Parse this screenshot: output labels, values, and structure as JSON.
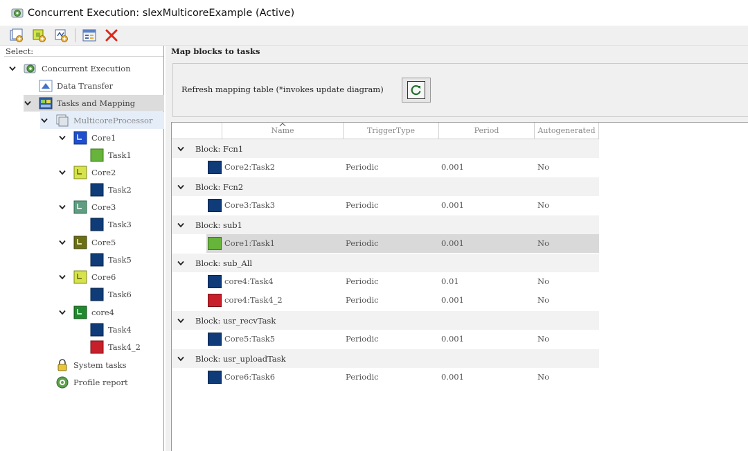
{
  "window": {
    "title": "Concurrent Execution: slexMulticoreExample (Active)"
  },
  "toolbar": {
    "icons": [
      "add-task-icon",
      "add-core-icon",
      "add-periodic-icon",
      "properties-icon",
      "delete-icon"
    ]
  },
  "left_pane": {
    "header": "Select:",
    "tree": {
      "root": "Concurrent Execution",
      "data_transfer": "Data Transfer",
      "tasks_mapping": "Tasks and Mapping",
      "processor": "MulticoreProcessor",
      "cores": [
        {
          "name": "Core1",
          "color": "#1f4fcf",
          "tasks": [
            {
              "name": "Task1",
              "color": "#66b43a"
            }
          ]
        },
        {
          "name": "Core2",
          "color": "#d7e34c",
          "tasks": [
            {
              "name": "Task2",
              "color": "#0f3b78"
            }
          ]
        },
        {
          "name": "Core3",
          "color": "#5f9e82",
          "tasks": [
            {
              "name": "Task3",
              "color": "#0f3b78"
            }
          ]
        },
        {
          "name": "Core5",
          "color": "#6b6f14",
          "tasks": [
            {
              "name": "Task5",
              "color": "#0f3b78"
            }
          ]
        },
        {
          "name": "Core6",
          "color": "#d7e34c",
          "tasks": [
            {
              "name": "Task6",
              "color": "#0f3b78"
            }
          ]
        },
        {
          "name": "core4",
          "color": "#21892d",
          "tasks": [
            {
              "name": "Task4",
              "color": "#0f3b78"
            },
            {
              "name": "Task4_2",
              "color": "#c8202a"
            }
          ]
        }
      ],
      "system_tasks": "System tasks",
      "profile_report": "Profile report"
    }
  },
  "right_pane": {
    "title": "Map blocks to tasks",
    "refresh_label": "Refresh mapping table (*invokes update diagram)",
    "columns": [
      "Name",
      "TriggerType",
      "Period",
      "Autogenerated"
    ],
    "groups": [
      {
        "block": "Block: Fcn1",
        "rows": [
          {
            "name": "Core2:Task2",
            "trigger": "Periodic",
            "period": "0.001",
            "auto": "No",
            "color": "#0f3b78"
          }
        ]
      },
      {
        "block": "Block: Fcn2",
        "rows": [
          {
            "name": "Core3:Task3",
            "trigger": "Periodic",
            "period": "0.001",
            "auto": "No",
            "color": "#0f3b78"
          }
        ]
      },
      {
        "block": "Block: sub1",
        "rows": [
          {
            "name": "Core1:Task1",
            "trigger": "Periodic",
            "period": "0.001",
            "auto": "No",
            "color": "#66b43a"
          }
        ]
      },
      {
        "block": "Block: sub_All",
        "rows": [
          {
            "name": "core4:Task4",
            "trigger": "Periodic",
            "period": "0.01",
            "auto": "No",
            "color": "#0f3b78"
          },
          {
            "name": "core4:Task4_2",
            "trigger": "Periodic",
            "period": "0.001",
            "auto": "No",
            "color": "#c8202a"
          }
        ]
      },
      {
        "block": "Block: usr_recvTask",
        "rows": [
          {
            "name": "Core5:Task5",
            "trigger": "Periodic",
            "period": "0.001",
            "auto": "No",
            "color": "#0f3b78"
          }
        ]
      },
      {
        "block": "Block: usr_uploadTask",
        "rows": [
          {
            "name": "Core6:Task6",
            "trigger": "Periodic",
            "period": "0.001",
            "auto": "No",
            "color": "#0f3b78"
          }
        ]
      }
    ]
  }
}
